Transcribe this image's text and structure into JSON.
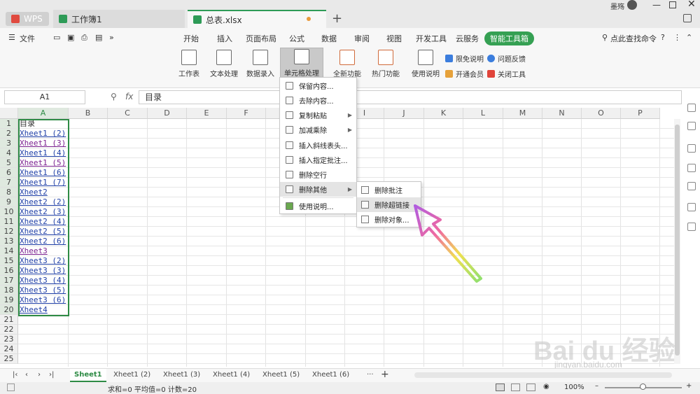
{
  "titlebar": {
    "tab_wps": "WPS",
    "tab_workbook": "工作簿1",
    "tab_active": "总表.xlsx",
    "user_name": "墨殇"
  },
  "menu": {
    "file": "文件",
    "items": [
      "开始",
      "插入",
      "页面布局",
      "公式",
      "数据",
      "审阅",
      "视图",
      "开发工具",
      "云服务"
    ],
    "active": "智能工具箱",
    "search": "点此查找命令"
  },
  "ribbon": {
    "worksheet": "工作表",
    "text_proc": "文本处理",
    "data_entry": "数据录入",
    "cell_proc": "单元格处理",
    "new_func": "全新功能",
    "hot_func": "热门功能",
    "usage": "使用说明",
    "free_note": "限免说明",
    "feedback": "问题反馈",
    "vip": "开通会员",
    "close_tool": "关闭工具"
  },
  "formula_bar": {
    "name_box": "A1",
    "fx": "fx",
    "content": "目录"
  },
  "grid": {
    "columns": [
      "A",
      "B",
      "C",
      "D",
      "E",
      "F",
      "G",
      "H",
      "I",
      "J",
      "K",
      "L",
      "M",
      "N",
      "O",
      "P"
    ],
    "rows": [
      "1",
      "2",
      "3",
      "4",
      "5",
      "6",
      "7",
      "8",
      "9",
      "10",
      "11",
      "12",
      "13",
      "14",
      "15",
      "16",
      "17",
      "18",
      "19",
      "20",
      "21",
      "22",
      "23",
      "24",
      "25"
    ],
    "col_a": [
      "目录",
      "Xheet1 (2)",
      "Xheet1 (3)",
      "Xheet1 (4)",
      "Xheet1 (5)",
      "Xheet1 (6)",
      "Xheet1 (7)",
      "Xheet2",
      "Xheet2 (2)",
      "Xheet2 (3)",
      "Xheet2 (4)",
      "Xheet2 (5)",
      "Xheet2 (6)",
      "Xheet3",
      "Xheet3 (2)",
      "Xheet3 (3)",
      "Xheet3 (4)",
      "Xheet3 (5)",
      "Xheet3 (6)",
      "Xheet4"
    ]
  },
  "dropdown": {
    "items": [
      "保留内容...",
      "去除内容...",
      "复制粘贴",
      "加减乘除",
      "插入斜线表头...",
      "插入指定批注...",
      "删除空行",
      "删除其他",
      "使用说明..."
    ]
  },
  "submenu": {
    "items": [
      "删除批注",
      "删除超链接",
      "删除对象..."
    ]
  },
  "sheets": [
    "Sheet1",
    "Xheet1 (2)",
    "Xheet1 (3)",
    "Xheet1 (4)",
    "Xheet1 (5)",
    "Xheet1 (6)"
  ],
  "status": {
    "summary": "求和=0  平均值=0  计数=20",
    "zoom": "100%"
  },
  "watermark": {
    "logo": "Bai du 经验",
    "url": "jingyan.baidu.com"
  },
  "colors": {
    "accent": "#2e8b45",
    "menu_active": "#35a053",
    "link": "#1f3fa6",
    "visited": "#7b2290"
  }
}
